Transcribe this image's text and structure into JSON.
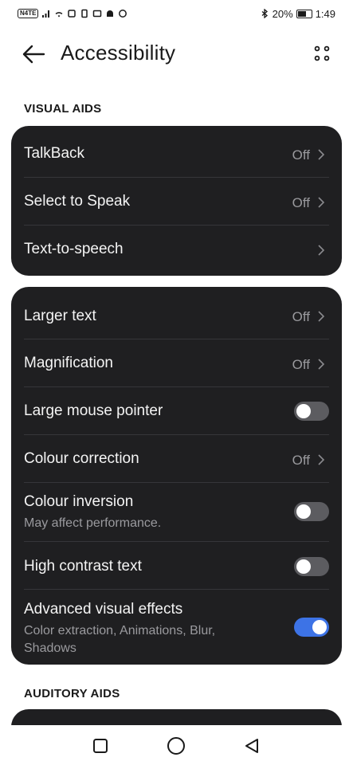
{
  "status_bar": {
    "network_badge": "N4TE",
    "battery_percent": "20%",
    "time": "1:49"
  },
  "header": {
    "title": "Accessibility"
  },
  "sections": {
    "visual_aids_label": "VISUAL AIDS",
    "auditory_aids_label": "AUDITORY AIDS"
  },
  "card1": {
    "talkback": {
      "label": "TalkBack",
      "value": "Off"
    },
    "select_to_speak": {
      "label": "Select to Speak",
      "value": "Off"
    },
    "text_to_speech": {
      "label": "Text-to-speech"
    }
  },
  "card2": {
    "larger_text": {
      "label": "Larger text",
      "value": "Off"
    },
    "magnification": {
      "label": "Magnification",
      "value": "Off"
    },
    "large_mouse_pointer": {
      "label": "Large mouse pointer",
      "enabled": false
    },
    "colour_correction": {
      "label": "Colour correction",
      "value": "Off"
    },
    "colour_inversion": {
      "label": "Colour inversion",
      "subtitle": "May affect performance.",
      "enabled": false
    },
    "high_contrast_text": {
      "label": "High contrast text",
      "enabled": false
    },
    "advanced_visual_effects": {
      "label": "Advanced visual effects",
      "subtitle": "Color extraction, Animations, Blur, Shadows",
      "enabled": true
    }
  },
  "colors": {
    "card_background": "#1f1f21",
    "toggle_on": "#3d73e6",
    "toggle_off": "#5c5c60",
    "secondary_text": "#9a9a9e"
  },
  "icons": {
    "back": "arrow-left-icon",
    "more": "more-dots-icon",
    "chevron": "chevron-right-icon",
    "nav_recents": "square-icon",
    "nav_home": "circle-icon",
    "nav_back": "triangle-back-icon"
  }
}
